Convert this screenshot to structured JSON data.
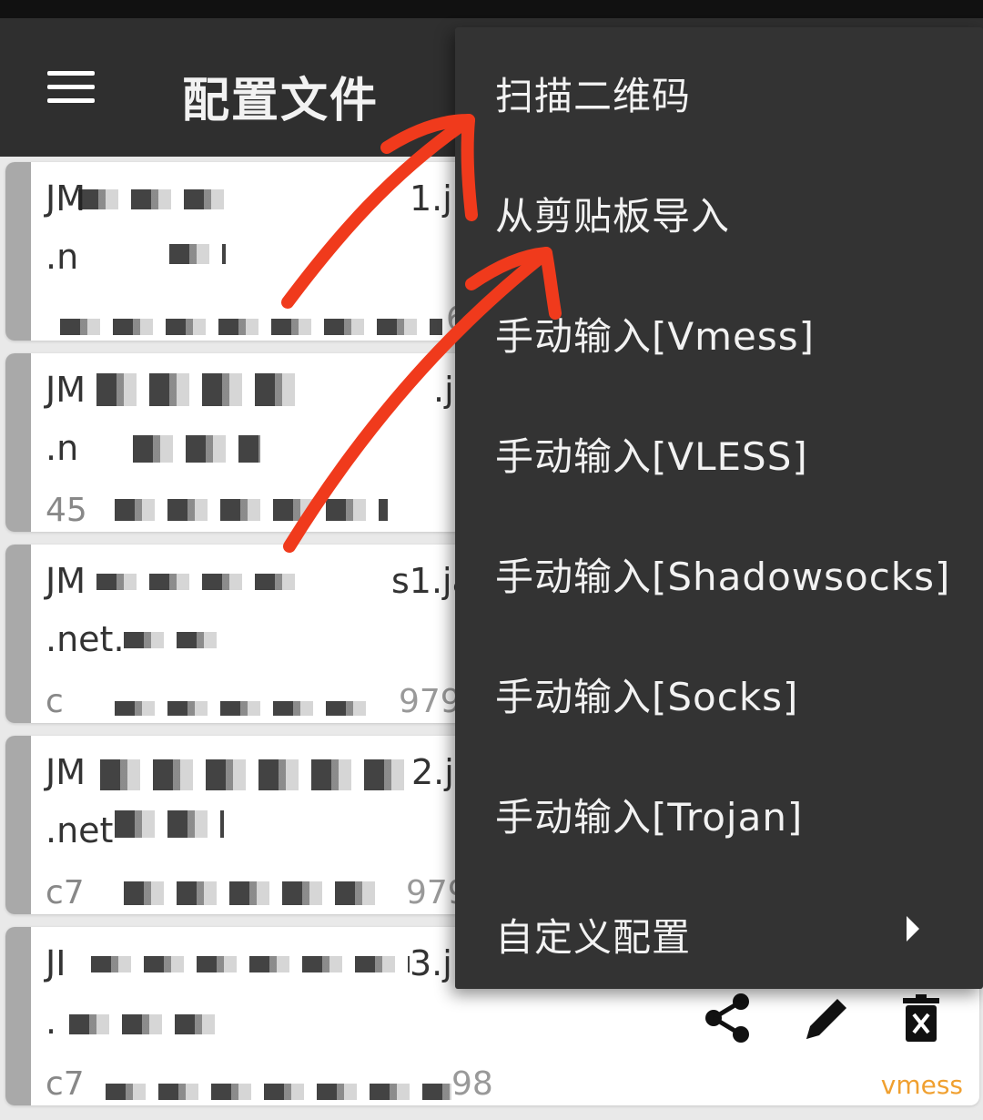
{
  "app_title": "配置文件",
  "menu": {
    "items": [
      {
        "label": "扫描二维码"
      },
      {
        "label": "从剪贴板导入"
      },
      {
        "label": "手动输入[Vmess]"
      },
      {
        "label": "手动输入[VLESS]"
      },
      {
        "label": "手动输入[Shadowsocks]"
      },
      {
        "label": "手动输入[Socks]"
      },
      {
        "label": "手动输入[Trojan]"
      },
      {
        "label": "自定义配置",
        "submenu": true
      }
    ]
  },
  "cards": [
    {
      "line1": "JM",
      "line1_end": "1.j",
      "line2": ".n",
      "line3": "",
      "num": "6"
    },
    {
      "line1": "JM",
      "line1_end": ".j",
      "line2": ".n",
      "line3": "45",
      "num": ""
    },
    {
      "line1": "JM",
      "line1_end": "s1.ja",
      "line2": ".net.",
      "line3": "c",
      "num": "979"
    },
    {
      "line1": "JM",
      "line1_end": "2.j",
      "line2": ".net",
      "line3": "c7",
      "num": "979"
    },
    {
      "line1": "JI",
      "line1_end": "3.j",
      "line2": ".",
      "line3": "c7",
      "num": "98"
    }
  ],
  "last_card_type": "vmess",
  "icons": {
    "menu": "hamburger-menu-icon",
    "share": "share-icon",
    "edit": "pencil-icon",
    "delete": "trash-icon",
    "submenu": "chevron-right-icon"
  },
  "colors": {
    "appbar": "#2f2f2f",
    "menu_bg": "#333333",
    "annotation_arrow": "#f03a1c",
    "type_tag": "#f0a030"
  }
}
